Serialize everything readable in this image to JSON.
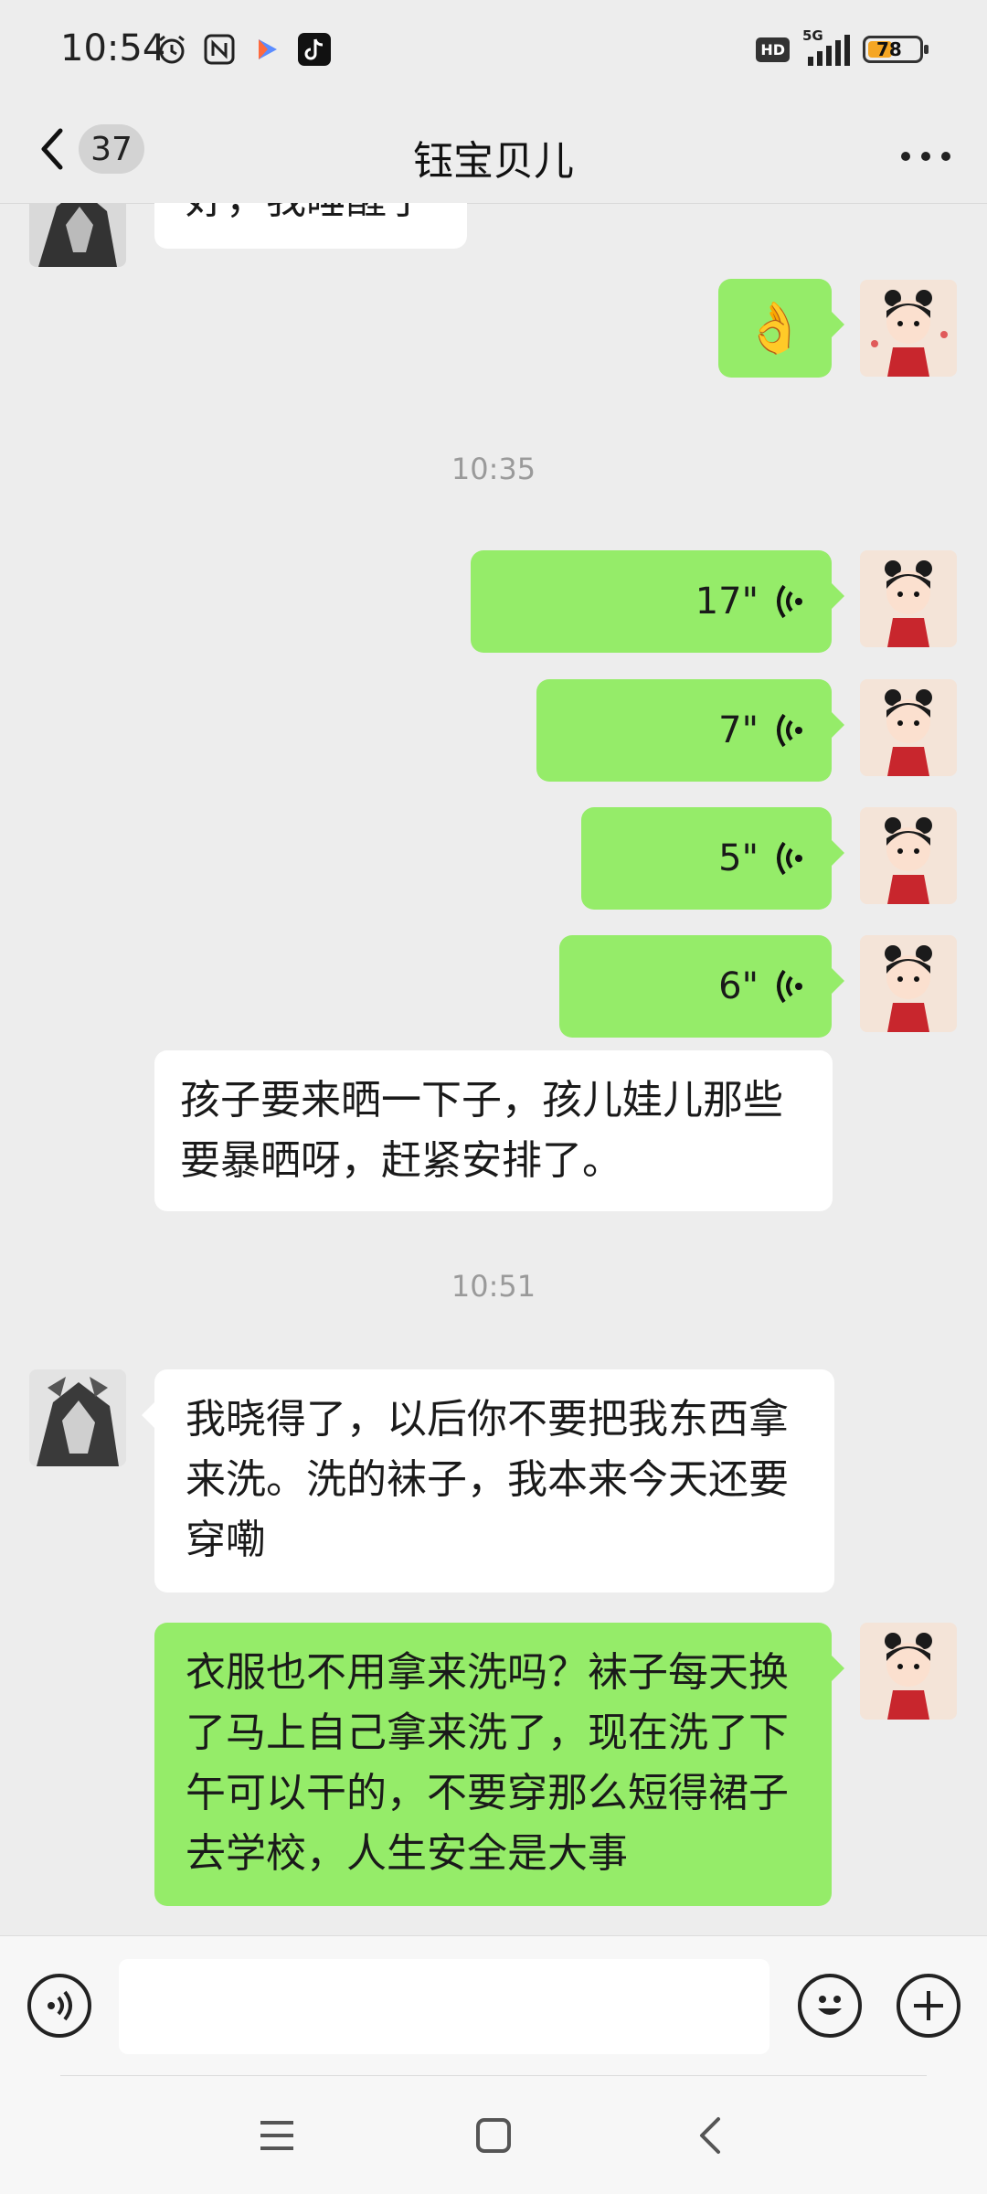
{
  "status_bar": {
    "time": "10:54",
    "icons": [
      "alarm-icon",
      "nfc-icon",
      "video-app-icon",
      "tiktok-icon"
    ],
    "hd_label": "HD",
    "network_label": "5G",
    "battery_level": "78",
    "battery_color": "#f5a623"
  },
  "header": {
    "back_badge": "37",
    "title": "钰宝贝儿"
  },
  "messages": {
    "partial_incoming": "好，我睡醒了",
    "emoji": "👌",
    "time_1": "10:35",
    "voice_1": "17\"",
    "voice_2": "7\"",
    "voice_3": "5\"",
    "voice_4": "6\"",
    "incoming_1": "孩子要来晒一下子，孩儿娃儿那些要暴晒呀，赶紧安排了。",
    "time_2": "10:51",
    "incoming_2": "我晓得了，以后你不要把我东西拿来洗。洗的袜子，我本来今天还要穿嘞",
    "outgoing_1": "衣服也不用拿来洗吗？袜子每天换了马上自己拿来洗了，现在洗了下午可以干的，不要穿那么短得裙子去学校，人生安全是大事"
  },
  "colors": {
    "outgoing_bubble": "#95ec69",
    "incoming_bubble": "#ffffff",
    "background": "#ededed"
  }
}
